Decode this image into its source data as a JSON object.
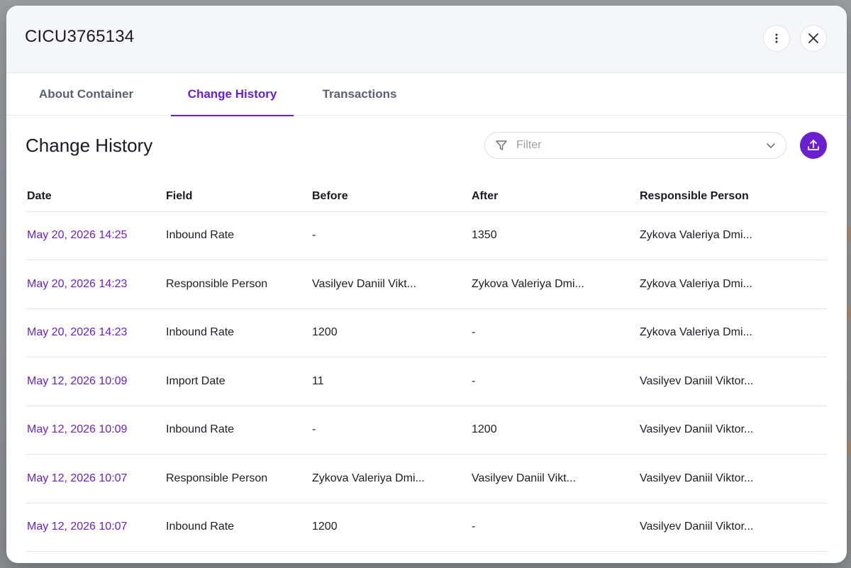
{
  "modal": {
    "title": "CICU3765134"
  },
  "tabs": [
    {
      "label": "About Container"
    },
    {
      "label": "Change History"
    },
    {
      "label": "Transactions"
    }
  ],
  "active_tab": "Change History",
  "section": {
    "title": "Change History"
  },
  "filter": {
    "placeholder": "Filter"
  },
  "table": {
    "headers": [
      "Date",
      "Field",
      "Before",
      "After",
      "Responsible Person"
    ],
    "rows": [
      [
        "May 20, 2026 14:25",
        "Inbound Rate",
        "-",
        "1350",
        "Zykova Valeriya Dmi..."
      ],
      [
        "May 20, 2026 14:23",
        "Responsible Person",
        "Vasilyev Daniil Vikt...",
        "Zykova Valeriya Dmi...",
        "Zykova Valeriya Dmi..."
      ],
      [
        "May 20, 2026 14:23",
        "Inbound Rate",
        "1200",
        "-",
        "Zykova Valeriya Dmi..."
      ],
      [
        "May 12, 2026 10:09",
        "Import Date",
        "11",
        "-",
        "Vasilyev Daniil Viktor..."
      ],
      [
        "May 12, 2026 10:09",
        "Inbound Rate",
        "-",
        "1200",
        "Vasilyev Daniil Viktor..."
      ],
      [
        "May 12, 2026 10:07",
        "Responsible Person",
        "Zykova Valeriya Dmi...",
        "Vasilyev Daniil Vikt...",
        "Vasilyev Daniil Viktor..."
      ],
      [
        "May 12, 2026 10:07",
        "Inbound Rate",
        "1200",
        "-",
        "Vasilyev Daniil Viktor..."
      ]
    ]
  },
  "colors": {
    "accent": "#6a1fd0",
    "header_bg": "#f4f6fa"
  },
  "icons": {
    "more": "more-vertical-icon",
    "close": "close-icon",
    "filter": "filter-icon",
    "dropdown": "chevron-down-icon",
    "export": "export-upload-icon"
  }
}
